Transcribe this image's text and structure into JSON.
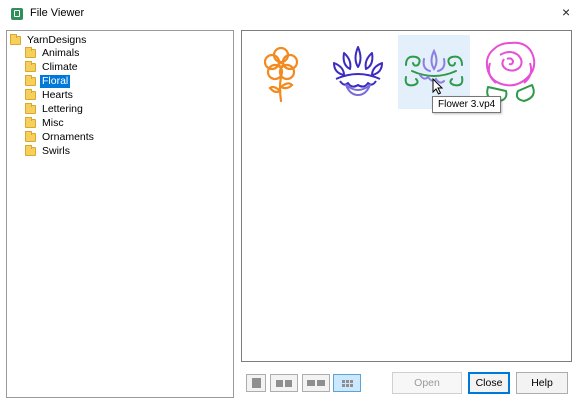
{
  "window": {
    "title": "File Viewer",
    "close_glyph": "×"
  },
  "tree": {
    "root": "YarnDesigns",
    "items": [
      {
        "label": "Animals",
        "selected": false
      },
      {
        "label": "Climate",
        "selected": false
      },
      {
        "label": "Floral",
        "selected": true
      },
      {
        "label": "Hearts",
        "selected": false
      },
      {
        "label": "Lettering",
        "selected": false
      },
      {
        "label": "Misc",
        "selected": false
      },
      {
        "label": "Ornaments",
        "selected": false
      },
      {
        "label": "Swirls",
        "selected": false
      }
    ]
  },
  "preview": {
    "thumbnails": [
      {
        "icon": "orange-flower-icon",
        "color": "#f28a1f"
      },
      {
        "icon": "blue-lotus-icon",
        "color": "#3b2bc2"
      },
      {
        "icon": "green-purple-flower-icon",
        "color": "#2e9a4a",
        "highlighted": true
      },
      {
        "icon": "pink-rose-icon",
        "color": "#e64fd6"
      }
    ],
    "tooltip": "Flower 3.vp4"
  },
  "footer": {
    "view_modes": [
      "single-view-icon",
      "two-up-view-icon",
      "wide-view-icon",
      "grid-view-icon"
    ],
    "active_view": "grid-view-icon",
    "buttons": {
      "open": "Open",
      "close": "Close",
      "help": "Help"
    }
  }
}
